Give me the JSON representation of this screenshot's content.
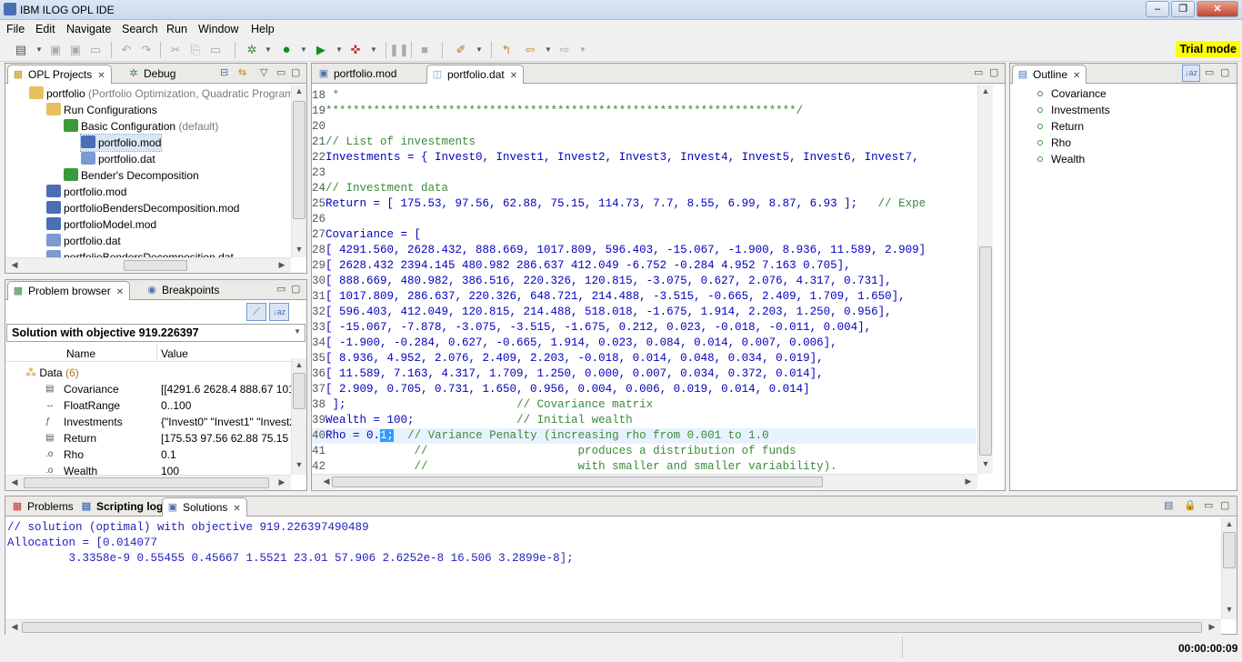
{
  "window": {
    "title": "IBM ILOG OPL IDE"
  },
  "menu": [
    "File",
    "Edit",
    "Navigate",
    "Search",
    "Run",
    "Window",
    "Help"
  ],
  "toolbar": {
    "trial_label": "Trial mode"
  },
  "projects_panel": {
    "tabs": [
      {
        "label": "OPL Projects",
        "icon": "projects-icon"
      },
      {
        "label": "Debug",
        "icon": "debug-icon"
      }
    ],
    "tree": [
      {
        "label": "portfolio",
        "suffix": "(Portfolio Optimization, Quadratic Program",
        "icon": "project-folder-icon",
        "level": 0,
        "color": "#e8c060"
      },
      {
        "label": "Run Configurations",
        "suffix": "",
        "icon": "folder-icon",
        "level": 1,
        "color": "#e8c060"
      },
      {
        "label": "Basic Configuration",
        "suffix": "(default)",
        "icon": "run-config-icon",
        "level": 2,
        "color": "#3a9a3a"
      },
      {
        "label": "portfolio.mod",
        "suffix": "",
        "icon": "mod-file-icon",
        "level": 3,
        "color": "#4a6fb5",
        "selected": true
      },
      {
        "label": "portfolio.dat",
        "suffix": "",
        "icon": "dat-file-icon",
        "level": 3,
        "color": "#7a9ad0"
      },
      {
        "label": "Bender's Decomposition",
        "suffix": "",
        "icon": "run-config-icon",
        "level": 2,
        "color": "#3a9a3a"
      },
      {
        "label": "portfolio.mod",
        "suffix": "",
        "icon": "mod-file-icon",
        "level": 1,
        "color": "#4a6fb5"
      },
      {
        "label": "portfolioBendersDecomposition.mod",
        "suffix": "",
        "icon": "mod-file-icon",
        "level": 1,
        "color": "#4a6fb5"
      },
      {
        "label": "portfolioModel.mod",
        "suffix": "",
        "icon": "mod-file-icon",
        "level": 1,
        "color": "#4a6fb5"
      },
      {
        "label": "portfolio.dat",
        "suffix": "",
        "icon": "dat-file-icon",
        "level": 1,
        "color": "#7a9ad0"
      },
      {
        "label": "portfolioBendersDecomposition.dat",
        "suffix": "",
        "icon": "dat-file-icon",
        "level": 1,
        "color": "#7a9ad0"
      }
    ]
  },
  "problem_browser": {
    "tabs": [
      {
        "label": "Problem browser",
        "icon": "problem-browser-icon"
      },
      {
        "label": "Breakpoints",
        "icon": "breakpoints-icon"
      }
    ],
    "selector": "Solution with objective 919.226397",
    "columns": [
      "Name",
      "Value"
    ],
    "group": {
      "label": "Data",
      "count": "(6)"
    },
    "rows": [
      {
        "name": "Covariance",
        "value": "[[4291.6 2628.4 888.67 1017.",
        "icon": "array-icon"
      },
      {
        "name": "FloatRange",
        "value": "0..100",
        "icon": "range-icon"
      },
      {
        "name": "Investments",
        "value": "{\"Invest0\" \"Invest1\" \"Invest2",
        "icon": "set-icon"
      },
      {
        "name": "Return",
        "value": "[175.53 97.56 62.88 75.15 11",
        "icon": "array-icon"
      },
      {
        "name": "Rho",
        "value": "0.1",
        "icon": "scalar-icon"
      },
      {
        "name": "Wealth",
        "value": "100",
        "icon": "scalar-icon"
      }
    ]
  },
  "editor": {
    "tabs": [
      {
        "label": "portfolio.mod",
        "icon": "mod-file-icon"
      },
      {
        "label": "portfolio.dat",
        "icon": "dat-file-icon"
      }
    ],
    "lines": [
      {
        "n": "18",
        "segs": [
          {
            "t": " *",
            "c": "cm"
          }
        ]
      },
      {
        "n": "19",
        "segs": [
          {
            "t": "*********************************************************************/",
            "c": "cm"
          }
        ]
      },
      {
        "n": "20",
        "segs": []
      },
      {
        "n": "21",
        "segs": [
          {
            "t": "// List of investments",
            "c": "cm"
          }
        ]
      },
      {
        "n": "22",
        "segs": [
          {
            "t": "Investments = { Invest0, Invest1, Invest2, Invest3, Invest4, Invest5, Invest6, Invest7,",
            "c": "kw"
          }
        ]
      },
      {
        "n": "23",
        "segs": []
      },
      {
        "n": "24",
        "segs": [
          {
            "t": "// Investment data",
            "c": "cm"
          }
        ]
      },
      {
        "n": "25",
        "segs": [
          {
            "t": "Return = [ 175.53, 97.56, 62.88, 75.15, 114.73, 7.7, 8.55, 6.99, 8.87, 6.93 ];   ",
            "c": "kw"
          },
          {
            "t": "// Expe",
            "c": "cm"
          }
        ]
      },
      {
        "n": "26",
        "segs": []
      },
      {
        "n": "27",
        "segs": [
          {
            "t": "Covariance = [",
            "c": "kw"
          }
        ]
      },
      {
        "n": "28",
        "segs": [
          {
            "t": "[ 4291.560, 2628.432, 888.669, 1017.809, 596.403, -15.067, -1.900, 8.936, 11.589, 2.909]",
            "c": "kw"
          }
        ]
      },
      {
        "n": "29",
        "segs": [
          {
            "t": "[ 2628.432 2394.145 480.982 286.637 412.049 -6.752 -0.284 4.952 7.163 0.705],",
            "c": "kw"
          }
        ]
      },
      {
        "n": "30",
        "segs": [
          {
            "t": "[ 888.669, 480.982, 386.516, 220.326, 120.815, -3.075, 0.627, 2.076, 4.317, 0.731],",
            "c": "kw"
          }
        ]
      },
      {
        "n": "31",
        "segs": [
          {
            "t": "[ 1017.809, 286.637, 220.326, 648.721, 214.488, -3.515, -0.665, 2.409, 1.709, 1.650],",
            "c": "kw"
          }
        ]
      },
      {
        "n": "32",
        "segs": [
          {
            "t": "[ 596.403, 412.049, 120.815, 214.488, 518.018, -1.675, 1.914, 2.203, 1.250, 0.956],",
            "c": "kw"
          }
        ]
      },
      {
        "n": "33",
        "segs": [
          {
            "t": "[ -15.067, -7.878, -3.075, -3.515, -1.675, 0.212, 0.023, -0.018, -0.011, 0.004],",
            "c": "kw"
          }
        ]
      },
      {
        "n": "34",
        "segs": [
          {
            "t": "[ -1.900, -0.284, 0.627, -0.665, 1.914, 0.023, 0.084, 0.014, 0.007, 0.006],",
            "c": "kw"
          }
        ]
      },
      {
        "n": "35",
        "segs": [
          {
            "t": "[ 8.936, 4.952, 2.076, 2.409, 2.203, -0.018, 0.014, 0.048, 0.034, 0.019],",
            "c": "kw"
          }
        ]
      },
      {
        "n": "36",
        "segs": [
          {
            "t": "[ 11.589, 7.163, 4.317, 1.709, 1.250, 0.000, 0.007, 0.034, 0.372, 0.014],",
            "c": "kw"
          }
        ]
      },
      {
        "n": "37",
        "segs": [
          {
            "t": "[ 2.909, 0.705, 0.731, 1.650, 0.956, 0.004, 0.006, 0.019, 0.014, 0.014]",
            "c": "kw"
          }
        ]
      },
      {
        "n": "38",
        "segs": [
          {
            "t": " ];                         ",
            "c": "kw"
          },
          {
            "t": "// Covariance matrix",
            "c": "cm"
          }
        ]
      },
      {
        "n": "39",
        "segs": [
          {
            "t": "Wealth = 100;               ",
            "c": "kw"
          },
          {
            "t": "// Initial wealth",
            "c": "cm"
          }
        ]
      },
      {
        "n": "40",
        "segs": [
          {
            "t": "Rho = 0.",
            "c": "kw"
          },
          {
            "t": "1;",
            "c": "sel"
          },
          {
            "t": "  ",
            "c": "kw"
          },
          {
            "t": "// Variance Penalty (increasing rho from 0.001 to 1.0",
            "c": "cm"
          }
        ],
        "current": true
      },
      {
        "n": "41",
        "segs": [
          {
            "t": "             //                      produces a distribution of funds",
            "c": "cm"
          }
        ]
      },
      {
        "n": "42",
        "segs": [
          {
            "t": "             //                      with smaller and smaller variability).",
            "c": "cm"
          }
        ]
      }
    ]
  },
  "outline": {
    "tabs": [
      {
        "label": "Outline",
        "icon": "outline-icon"
      }
    ],
    "items": [
      "Covariance",
      "Investments",
      "Return",
      "Rho",
      "Wealth"
    ]
  },
  "bottom": {
    "tabs": [
      {
        "label": "Problems",
        "icon": "problems-icon"
      },
      {
        "label": "Scripting log",
        "icon": "scripting-log-icon"
      },
      {
        "label": "Solutions",
        "icon": "solutions-icon"
      }
    ],
    "console": [
      "// solution (optimal) with objective 919.226397490489",
      "Allocation = [0.014077",
      "         3.3358e-9 0.55455 0.45667 1.5521 23.01 57.906 2.6252e-8 16.506 3.2899e-8];"
    ]
  },
  "status": {
    "timer": "00:00:00:09"
  }
}
